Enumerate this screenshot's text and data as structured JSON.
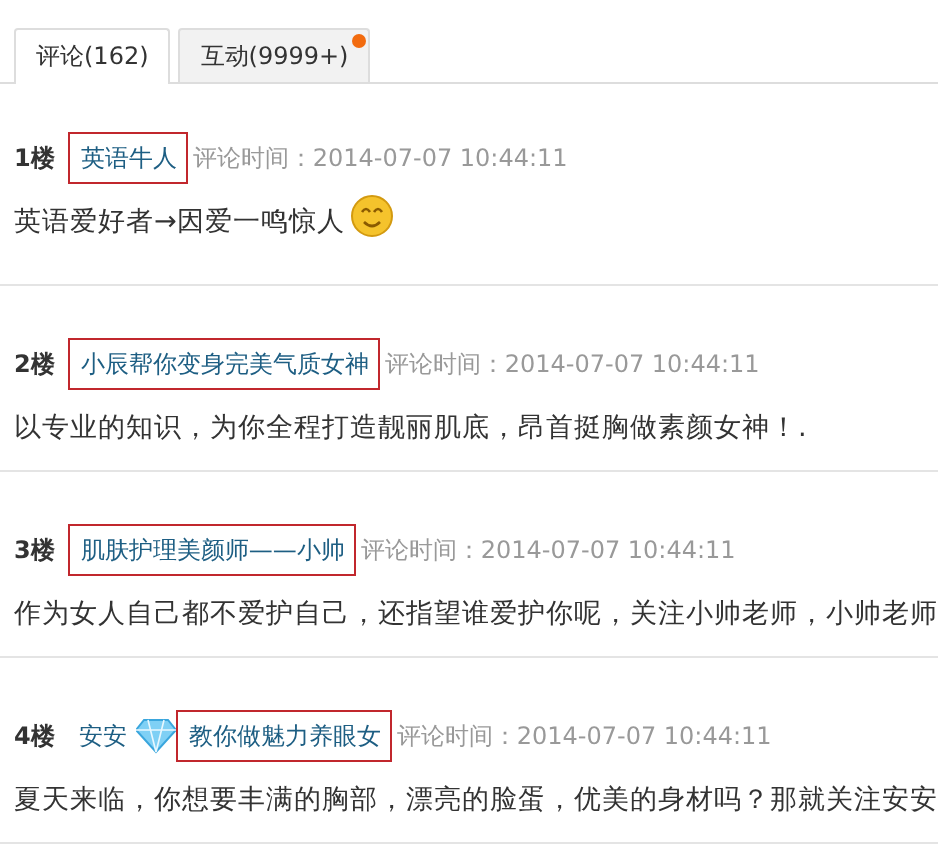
{
  "tabs": [
    {
      "label": "评论(162)",
      "selected": true,
      "dot": false
    },
    {
      "label": "互动(9999+)",
      "selected": false,
      "dot": true
    }
  ],
  "posts": [
    {
      "floor": "1楼",
      "name": "英语牛人",
      "highlighted": true,
      "time": "评论时间：2014-07-07 10:44:11",
      "text": "英语爱好者→因爱一鸣惊人",
      "emoji": true
    },
    {
      "floor": "2楼",
      "name": "小辰帮你变身完美气质女神",
      "highlighted": true,
      "time": "评论时间：2014-07-07 10:44:11",
      "text": "以专业的知识，为你全程打造靓丽肌底，昂首挺胸做素颜女神！."
    },
    {
      "floor": "3楼",
      "name": "肌肤护理美颜师——小帅",
      "highlighted": true,
      "time": "评论时间：2014-07-07 10:44:11",
      "text": "作为女人自己都不爱护自己，还指望谁爱护你呢，关注小帅老师，小帅老师"
    },
    {
      "floor": "4楼",
      "author": "安安",
      "author_badge": true,
      "name": "教你做魅力养眼女",
      "highlighted": true,
      "time": "评论时间：2014-07-07 10:44:11",
      "text": "夏天来临，你想要丰满的胸部，漂亮的脸蛋，优美的身材吗？那就关注安安"
    }
  ]
}
